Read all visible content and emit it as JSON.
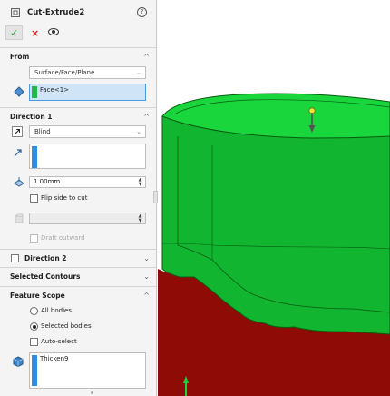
{
  "feature": {
    "title": "Cut-Extrude2",
    "help_symbol": "?",
    "ok_symbol": "✓",
    "cancel_symbol": "×",
    "icons": [
      "cut-extrude-icon",
      "help-icon",
      "ok-icon",
      "cancel-icon",
      "preview-eye-icon"
    ]
  },
  "from": {
    "header": "From",
    "type": "Surface/Face/Plane",
    "selection": "Face<1>",
    "selection_color": "#1db94a"
  },
  "direction1": {
    "header": "Direction 1",
    "end_condition": "Blind",
    "depth": "1.00mm",
    "flip_side_to_cut": "Flip side to cut",
    "draft_outward": "Draft outward",
    "direction_selection_color": "#2f8de4"
  },
  "direction2": {
    "header": "Direction 2"
  },
  "selected_contours": {
    "header": "Selected Contours"
  },
  "feature_scope": {
    "header": "Feature Scope",
    "option_all": "All bodies",
    "option_selected": "Selected bodies",
    "auto_select": "Auto-select",
    "selected_option": "Selected bodies",
    "bodies": [
      "Thicken9"
    ]
  },
  "chevrons": {
    "up": "^",
    "down": "⌄",
    "dropdown": "⌄",
    "spin_up": "▲",
    "spin_down": "▼"
  },
  "model_colors": {
    "face_green": "#19d63c",
    "side_green": "#11b52f",
    "edge": "#0a5a12",
    "body_red": "#8e0c05"
  }
}
